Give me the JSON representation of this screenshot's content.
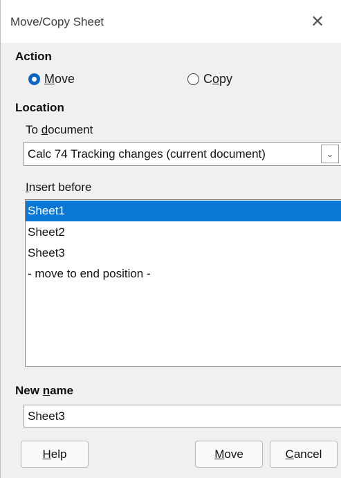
{
  "window": {
    "title": "Move/Copy Sheet",
    "close_glyph": "✕"
  },
  "action": {
    "heading": "Action",
    "move_label": "Move",
    "copy_label": "Copy",
    "selected": "move"
  },
  "location": {
    "heading": "Location",
    "to_document_label": "To document",
    "document_value": "Calc 74 Tracking changes (current document)",
    "insert_before_label": "Insert before",
    "items": [
      "Sheet1",
      "Sheet2",
      "Sheet3",
      "- move to end position -"
    ],
    "selected_index": 0
  },
  "new_name": {
    "label": "New name",
    "value": "Sheet3"
  },
  "buttons": {
    "help": "Help",
    "move": "Move",
    "cancel": "Cancel"
  },
  "colors": {
    "accent": "#0a64c8",
    "selection": "#0a78d7",
    "dialog_bg": "#f0f0f0"
  }
}
